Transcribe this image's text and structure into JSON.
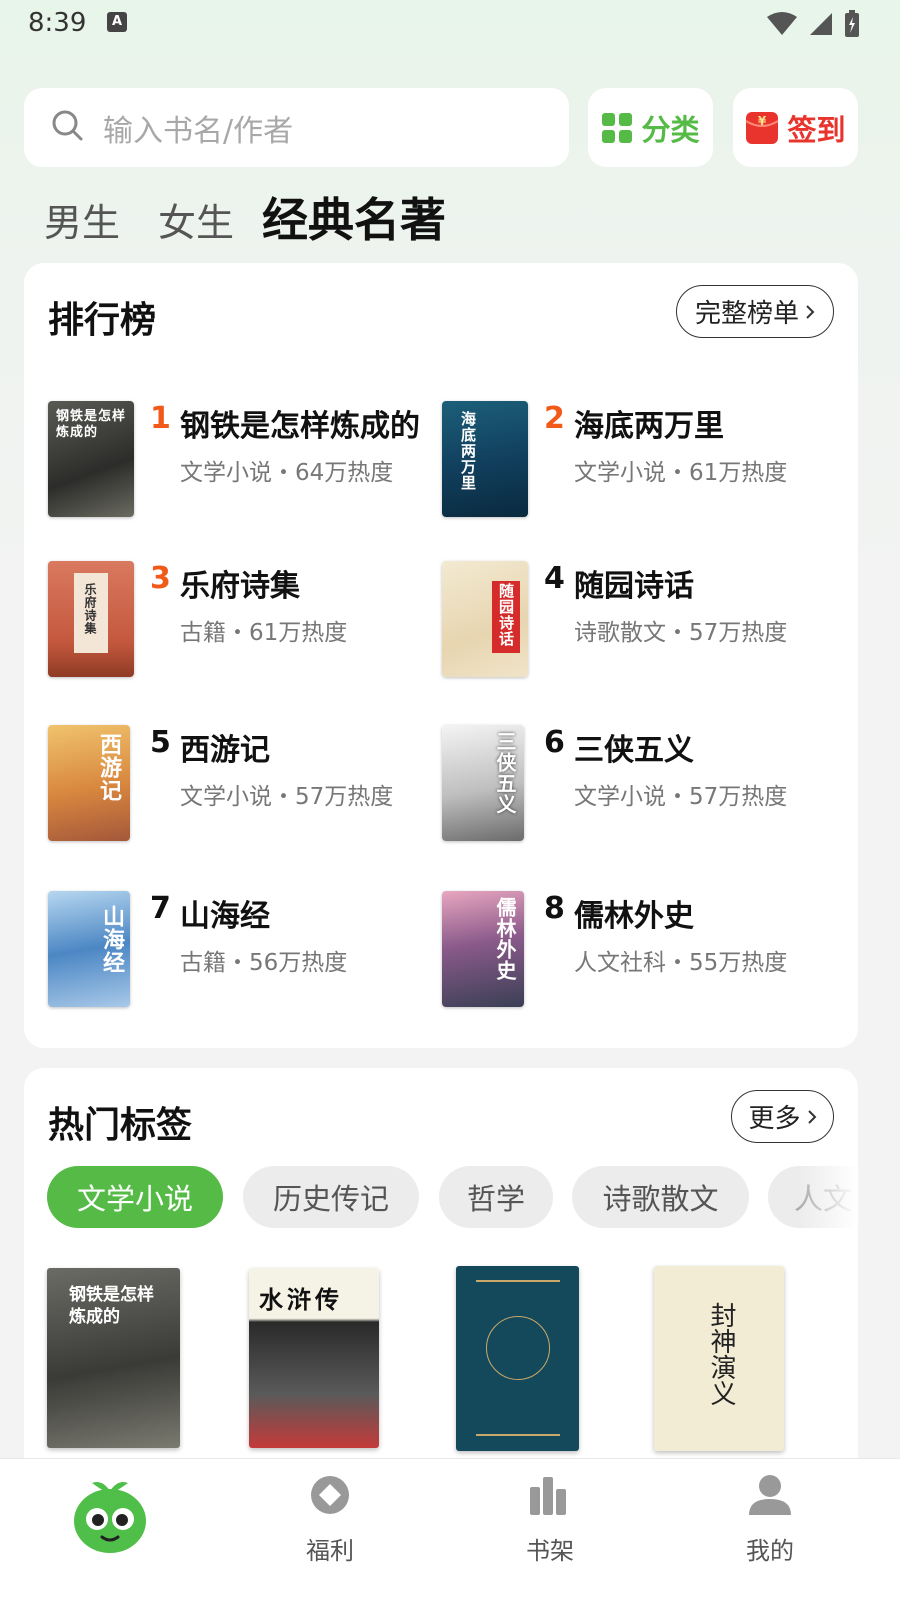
{
  "status_bar": {
    "time": "8:39",
    "notification_badge": "A"
  },
  "search": {
    "placeholder": "输入书名/作者"
  },
  "top_buttons": {
    "category": "分类",
    "checkin": "签到"
  },
  "tabs": [
    {
      "label": "男生",
      "active": false
    },
    {
      "label": "女生",
      "active": false
    },
    {
      "label": "经典名著",
      "active": true
    }
  ],
  "ranking": {
    "title": "排行榜",
    "more": "完整榜单",
    "items": [
      {
        "rank": "1",
        "title": "钢铁是怎样炼成的",
        "meta": "文学小说・64万热度",
        "cover_text": "钢铁是怎样炼成的",
        "highlight": true
      },
      {
        "rank": "2",
        "title": "海底两万里",
        "meta": "文学小说・61万热度",
        "cover_text": "海底两万里",
        "highlight": true
      },
      {
        "rank": "3",
        "title": "乐府诗集",
        "meta": "古籍・61万热度",
        "cover_text": "乐府诗集",
        "highlight": true
      },
      {
        "rank": "4",
        "title": "随园诗话",
        "meta": "诗歌散文・57万热度",
        "cover_text": "随园诗话",
        "highlight": false
      },
      {
        "rank": "5",
        "title": "西游记",
        "meta": "文学小说・57万热度",
        "cover_text": "西游记",
        "highlight": false
      },
      {
        "rank": "6",
        "title": "三侠五义",
        "meta": "文学小说・57万热度",
        "cover_text": "三侠五义",
        "highlight": false
      },
      {
        "rank": "7",
        "title": "山海经",
        "meta": "古籍・56万热度",
        "cover_text": "山海经",
        "highlight": false
      },
      {
        "rank": "8",
        "title": "儒林外史",
        "meta": "人文社科・55万热度",
        "cover_text": "儒林外史",
        "highlight": false
      }
    ]
  },
  "hot_tags": {
    "title": "热门标签",
    "more": "更多",
    "tags": [
      "文学小说",
      "历史传记",
      "哲学",
      "诗歌散文",
      "人文"
    ],
    "books": [
      {
        "cover_text": "钢铁是怎样炼成的"
      },
      {
        "cover_text": "水浒传"
      },
      {
        "cover_text": ""
      },
      {
        "cover_text": "封神演义"
      }
    ]
  },
  "bottom_nav": {
    "items": [
      {
        "label": "",
        "icon": "home-mascot-icon"
      },
      {
        "label": "福利",
        "icon": "diamond-icon"
      },
      {
        "label": "书架",
        "icon": "bookshelf-icon"
      },
      {
        "label": "我的",
        "icon": "profile-icon"
      }
    ]
  },
  "colors": {
    "accent_green": "#55bb46",
    "rank_orange": "#f25a1a",
    "checkin_red": "#e8342c"
  }
}
